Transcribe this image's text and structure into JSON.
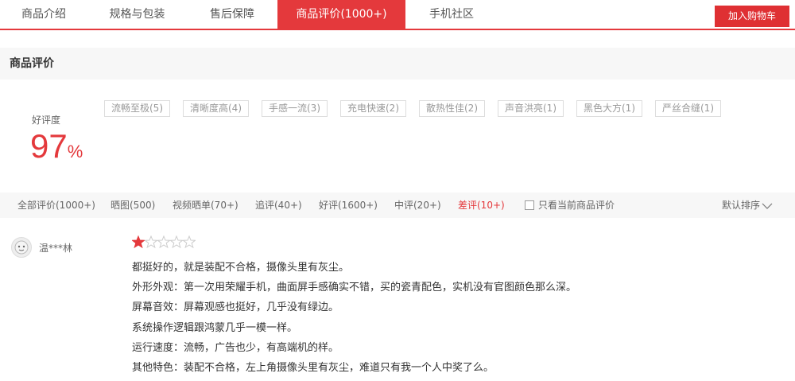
{
  "tabs": [
    {
      "label": "商品介绍",
      "active": false
    },
    {
      "label": "规格与包装",
      "active": false
    },
    {
      "label": "售后保障",
      "active": false
    },
    {
      "label": "商品评价(1000+)",
      "active": true
    },
    {
      "label": "手机社区",
      "active": false
    }
  ],
  "cart_button": "加入购物车",
  "section_title": "商品评价",
  "rating": {
    "label": "好评度",
    "value": "97",
    "unit": "%"
  },
  "tags": [
    "流畅至极(5)",
    "清晰度高(4)",
    "手感一流(3)",
    "充电快速(2)",
    "散热性佳(2)",
    "声音洪亮(1)",
    "黑色大方(1)",
    "严丝合缝(1)"
  ],
  "filters": [
    {
      "label": "全部评价(1000+)",
      "active": false
    },
    {
      "label": "晒图(500)",
      "active": false
    },
    {
      "label": "视频晒单(70+)",
      "active": false
    },
    {
      "label": "追评(40+)",
      "active": false
    },
    {
      "label": "好评(1600+)",
      "active": false
    },
    {
      "label": "中评(20+)",
      "active": false
    },
    {
      "label": "差评(10+)",
      "active": true
    }
  ],
  "only_current_label": "只看当前商品评价",
  "only_current_checked": false,
  "sort_label": "默认排序",
  "review": {
    "username": "温***林",
    "stars": 1,
    "max_stars": 5,
    "lines": [
      "都挺好的，就是装配不合格，摄像头里有灰尘。",
      "外形外观：第一次用荣耀手机，曲面屏手感确实不错，买的瓷青配色，实机没有官图颜色那么深。",
      "屏幕音效：屏幕观感也挺好，几乎没有绿边。",
      "系统操作逻辑跟鸿蒙几乎一模一样。",
      "运行速度：流畅，广告也少，有高端机的样。",
      "其他特色：装配不合格，左上角摄像头里有灰尘，难道只有我一个人中奖了么。"
    ]
  },
  "colors": {
    "accent": "#e4393c",
    "star_filled": "#e4393c",
    "star_empty": "#cccccc"
  }
}
